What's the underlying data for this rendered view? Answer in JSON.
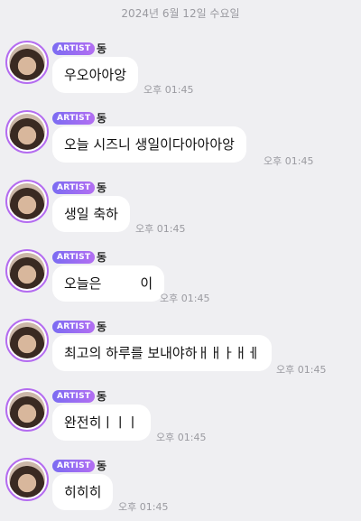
{
  "date_header": "2024년 6월 12일 수요일",
  "messages": [
    {
      "badge": "ARTIST",
      "author": "동",
      "text": "우오아아앙",
      "time": "오후 01:45"
    },
    {
      "badge": "ARTIST",
      "author": "동",
      "text": "오늘 시즈니 생일이다아아아앙",
      "time": "오후 01:45"
    },
    {
      "badge": "ARTIST",
      "author": "동",
      "text": "생일 축하",
      "time": "오후 01:45"
    },
    {
      "badge": "ARTIST",
      "author": "동",
      "text": "오늘은         이",
      "time": "오후 01:45"
    },
    {
      "badge": "ARTIST",
      "author": "동",
      "text": "최고의 하루를 보내야하ㅐㅐㅏㅐㅔ",
      "time": "오후 01:45"
    },
    {
      "badge": "ARTIST",
      "author": "동",
      "text": "완전히ㅣㅣㅣ",
      "time": "오후 01:45"
    },
    {
      "badge": "ARTIST",
      "author": "동",
      "text": "히히히",
      "time": "오후 01:45"
    }
  ]
}
